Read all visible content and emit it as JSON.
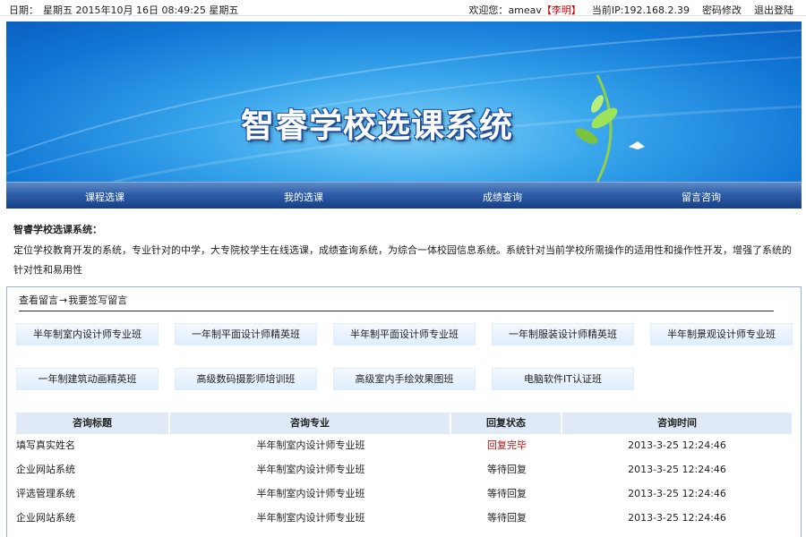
{
  "topbar": {
    "date_label": "日期：",
    "date_value": "星期五 2015年10月 16日 08:49:25 星期五",
    "welcome": "欢迎您：",
    "username": "ameav",
    "realname": "【李明】",
    "ip_label": "当前IP:",
    "ip_value": "192.168.2.39",
    "change_password": "密码修改",
    "logout": "退出登陆"
  },
  "banner": {
    "title": "智睿学校选课系统"
  },
  "nav": {
    "items": [
      "课程选课",
      "我的选课",
      "成绩查询",
      "留言咨询"
    ]
  },
  "intro": {
    "heading": "智睿学校选课系统：",
    "text": "定位学校教育开发的系统，专业针对的中学，大专院校学生在线选课，成绩查询系统，为综合一体校园信息系统。系统针对当前学校所需操作的适用性和操作性开发，增强了系统的针对性和易用性"
  },
  "breadcrumb": {
    "view": "查看留言",
    "arrow": "→",
    "write": "我要签写留言"
  },
  "courses": [
    "半年制室内设计师专业班",
    "一年制平面设计师精英班",
    "半年制平面设计师专业班",
    "一年制服装设计师精英班",
    "半年制景观设计师专业班",
    "一年制建筑动画精英班",
    "高级数码摄影师培训班",
    "高级室内手绘效果图班",
    "电脑软件IT认证班"
  ],
  "table": {
    "headers": [
      "咨询标题",
      "咨询专业",
      "回复状态",
      "咨询时间"
    ],
    "rows": [
      {
        "title": "填写真实姓名",
        "major": "半年制室内设计师专业班",
        "status": "回复完毕",
        "time": "2013-3-25 12:24:46"
      },
      {
        "title": "企业网站系统",
        "major": "半年制室内设计师专业班",
        "status": "等待回复",
        "time": "2013-3-25 12:24:46"
      },
      {
        "title": "评选管理系统",
        "major": "半年制室内设计师专业班",
        "status": "等待回复",
        "time": "2013-3-25 12:24:46"
      },
      {
        "title": "企业网站系统",
        "major": "半年制室内设计师专业班",
        "status": "等待回复",
        "time": "2013-3-25 12:24:46"
      }
    ]
  },
  "colors": {
    "accent": "#1d4f9a",
    "nav_dark": "#173f86",
    "status_done": "#b01010",
    "border": "#8fb4dd"
  }
}
